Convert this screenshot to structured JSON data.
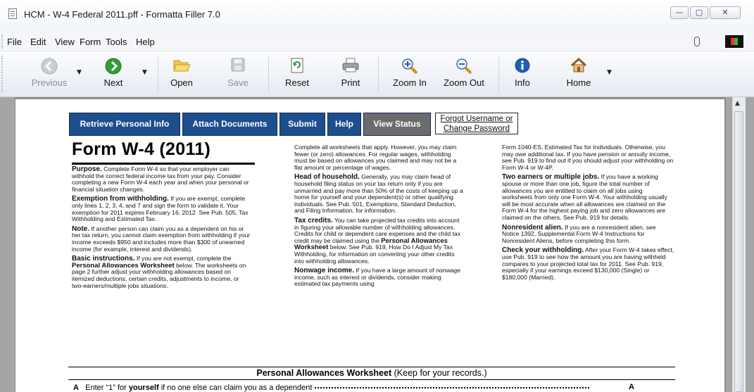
{
  "window": {
    "title": "HCM - W-4 Federal 2011.pff - Formatta Filler 7.0",
    "min_glyph": "—",
    "max_glyph": "▢",
    "close_glyph": "✕"
  },
  "menu": [
    "File",
    "Edit",
    "View",
    "Form",
    "Tools",
    "Help"
  ],
  "toolbar": {
    "previous": "Previous",
    "next": "Next",
    "open": "Open",
    "save": "Save",
    "reset": "Reset",
    "print": "Print",
    "zoom_in": "Zoom In",
    "zoom_out": "Zoom Out",
    "info": "Info",
    "home": "Home"
  },
  "form_nav": {
    "retrieve": "Retrieve Personal Info",
    "attach": "Attach Documents",
    "submit": "Submit",
    "help": "Help",
    "view_status": "View Status",
    "forgot_1": "Forgot Username or",
    "forgot_2": "Change Password"
  },
  "form": {
    "title": "Form W-4 (2011)",
    "col1": {
      "purpose_h": "Purpose.",
      "purpose": " Complete Form W-4 so that your employer can withhold the correct federal income tax from your pay. Consider completing a new Form W-4 each year and when your personal or financial situation changes.",
      "exempt_h": "Exemption from withholding.",
      "exempt": " If you are exempt, complete only lines 1, 2, 3, 4, and 7 and sign the form to validate it. Your exemption for 2011 expires February 16, 2012. See Pub. 505, Tax Withholding and Estimated Tax.",
      "note_h": "Note.",
      "note": " If another person can claim you as a dependent on his or her tax return, you cannot claim exemption from withholding if your income exceeds $950 and includes more than $300 of unearned income (for example, interest and dividends).",
      "basic_h": "Basic instructions.",
      "basic_1": " If you are not exempt, complete the ",
      "basic_b": "Personal Allowances Worksheet",
      "basic_2": " below. The worksheets on page 2 further adjust your withholding allowances based on itemized deductions, certain credits, adjustments to income, or two-earners/multiple jobs situations."
    },
    "col2": {
      "intro": "Complete all worksheets that apply. However, you may claim fewer (or zero) allowances. For regular wages, withholding must be based on allowances you claimed and may not be a flat amount or percentage of wages.",
      "hoh_h": "Head of household.",
      "hoh": " Generally, you may claim head of household filing status on your tax return only if you are unmarried and pay more than 50% of the costs of keeping up a home for yourself and your dependent(s) or other qualifying individuals. See Pub. 501, Exemptions, Standard Deduction, and Filing Information, for information.",
      "tax_h": "Tax credits.",
      "tax_1": " You can take projected tax credits into account in figuring your allowable number of withholding allowances. Credits for child or dependent care expenses and the child tax credit may be claimed using the ",
      "tax_b": "Personal Allowances Worksheet",
      "tax_2": " below. See Pub. 919, How Do I Adjust My Tax Withholding, for information on converting your other credits into withholding allowances.",
      "nonwage_h": "Nonwage income.",
      "nonwage": " If you have a large amount of nonwage income, such as interest or dividends, consider making estimated tax payments using"
    },
    "col3": {
      "intro": "Form 1040-ES, Estimated Tax for Individuals. Otherwise, you may owe additional tax. If you have pension or annuity income, see Pub. 919 to find out if you should adjust your withholding on Form W-4 or W-4P.",
      "two_h": "Two earners or multiple jobs.",
      "two": " If you have a working spouse or more than one job, figure the total number of allowances you are entitled to claim on all jobs using worksheets from only one Form W-4. Your withholding usually will be most accurate when all allowances are claimed on the Form W-4 for the highest paying job and zero allowances are claimed on the others. See Pub. 919 for details.",
      "nra_h": "Nonresident alien.",
      "nra": " If you are a nonresident alien, see Notice 1392, Supplemental Form W-4 Instructions for Nonresident Aliens, before completing this form.",
      "check_h": "Check your withholding.",
      "check": " After your Form W-4 takes effect, use Pub. 919 to see how the amount you are having withheld compares to your projected total tax for 2011. See Pub. 919, especially if your earnings exceed $130,000 (Single) or $180,000 (Married)."
    },
    "worksheet_title": "Personal Allowances Worksheet",
    "worksheet_sub": " (Keep for your records.)",
    "lineA_letter": "A",
    "lineA_pre": "Enter “1” for ",
    "lineA_bold": "yourself",
    "lineA_post": " if no one else can claim you as a dependent",
    "lineA_right": "A"
  }
}
